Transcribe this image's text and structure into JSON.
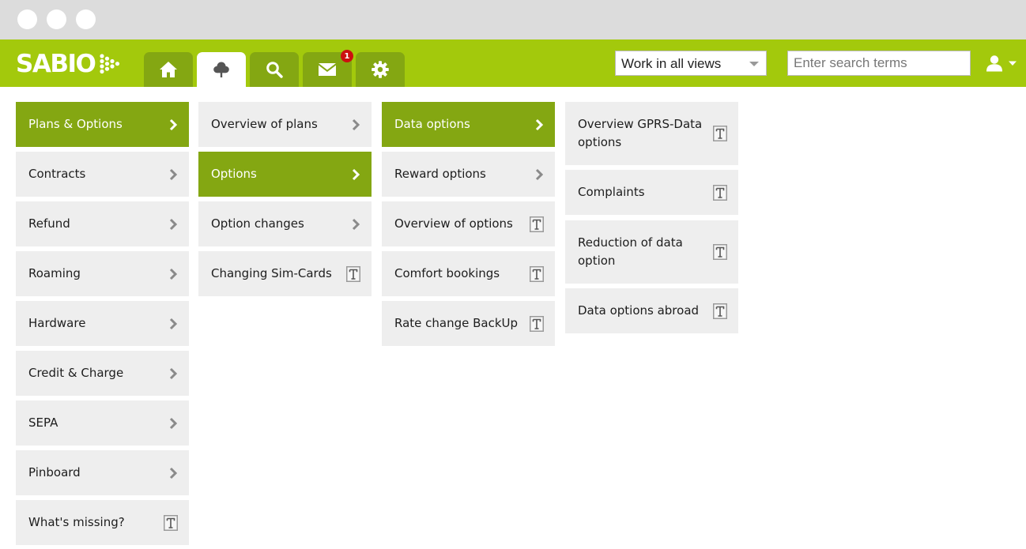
{
  "app": {
    "logo_text": "SABIO",
    "colors": {
      "brand_green": "#a3c90c",
      "tab_green": "#84a712",
      "selected_green": "#84a712",
      "tile_gray": "#eeeeee"
    }
  },
  "window": {
    "controls": [
      "close",
      "minimize",
      "maximize"
    ]
  },
  "nav": {
    "tabs": [
      {
        "icon": "home-icon",
        "active": false
      },
      {
        "icon": "cloud-icon",
        "active": true
      },
      {
        "icon": "search-icon",
        "active": false
      },
      {
        "icon": "mail-icon",
        "active": false,
        "badge": "1"
      },
      {
        "icon": "gear-icon",
        "active": false
      }
    ],
    "view_select": {
      "value": "Work in all views"
    },
    "search": {
      "placeholder": "Enter search terms"
    },
    "user_menu": {
      "icon": "user-icon"
    }
  },
  "columns": [
    {
      "items": [
        {
          "label": "Plans & Options",
          "selected": true,
          "icon": "chevron-right-icon"
        },
        {
          "label": "Contracts",
          "icon": "chevron-right-icon"
        },
        {
          "label": "Refund",
          "icon": "chevron-right-icon"
        },
        {
          "label": "Roaming",
          "icon": "chevron-right-icon"
        },
        {
          "label": "Hardware",
          "icon": "chevron-right-icon"
        },
        {
          "label": "Credit & Charge",
          "icon": "chevron-right-icon"
        },
        {
          "label": "SEPA",
          "icon": "chevron-right-icon"
        },
        {
          "label": "Pinboard",
          "icon": "chevron-right-icon"
        },
        {
          "label": "What's missing?",
          "icon": "text-document-icon"
        }
      ]
    },
    {
      "items": [
        {
          "label": "Overview of plans",
          "icon": "chevron-right-icon"
        },
        {
          "label": "Options",
          "selected": true,
          "icon": "chevron-right-icon"
        },
        {
          "label": "Option changes",
          "icon": "chevron-right-icon"
        },
        {
          "label": "Changing Sim-Cards",
          "icon": "text-document-icon"
        }
      ]
    },
    {
      "items": [
        {
          "label": "Data options",
          "selected": true,
          "icon": "chevron-right-icon"
        },
        {
          "label": "Reward options",
          "icon": "chevron-right-icon"
        },
        {
          "label": "Overview of options",
          "icon": "text-document-icon"
        },
        {
          "label": "Comfort bookings",
          "icon": "text-document-icon"
        },
        {
          "label": "Rate change BackUp",
          "icon": "text-document-icon"
        }
      ]
    },
    {
      "items": [
        {
          "label": "Overview GPRS-Data options",
          "icon": "text-document-icon"
        },
        {
          "label": "Complaints",
          "icon": "text-document-icon"
        },
        {
          "label": "Reduction of data option",
          "icon": "text-document-icon"
        },
        {
          "label": "Data options abroad",
          "icon": "text-document-icon"
        }
      ]
    }
  ]
}
